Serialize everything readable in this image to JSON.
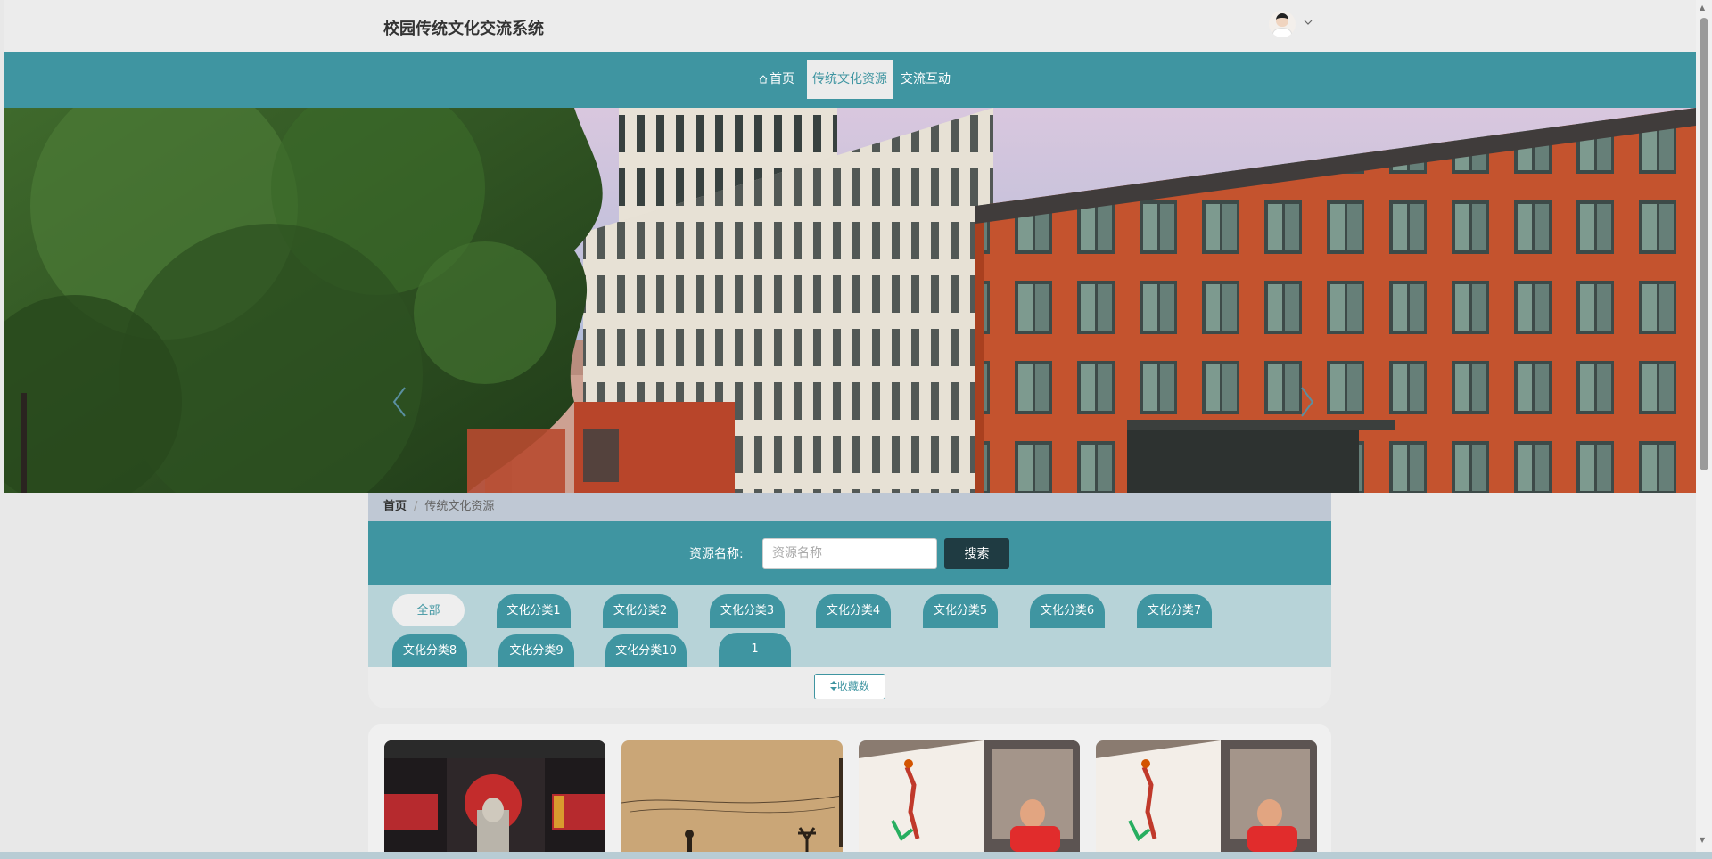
{
  "header": {
    "site_title": "校园传统文化交流系统"
  },
  "nav": {
    "items": [
      {
        "label": "首页"
      },
      {
        "label": "传统文化资源"
      },
      {
        "label": "交流互动"
      }
    ],
    "active": "传统文化资源"
  },
  "breadcrumb": {
    "home": "首页",
    "separator": "/",
    "current": "传统文化资源"
  },
  "search": {
    "label": "资源名称:",
    "placeholder": "资源名称",
    "value": "",
    "button": "搜索"
  },
  "categories": {
    "active": "全部",
    "items": [
      "全部",
      "文化分类1",
      "文化分类2",
      "文化分类3",
      "文化分类4",
      "文化分类5",
      "文化分类6",
      "文化分类7",
      "文化分类8",
      "文化分类9",
      "文化分类10",
      "1"
    ]
  },
  "sort": {
    "icon": "sort-icon",
    "label": "收藏数"
  },
  "colors": {
    "primary": "#3f95a1",
    "dark_button": "#1f3b42",
    "category_bg": "#b7d3d8",
    "breadcrumb_bg": "#bfc8d4"
  },
  "banner": {
    "icons": [
      "chevron-left-icon",
      "chevron-right-icon"
    ]
  }
}
